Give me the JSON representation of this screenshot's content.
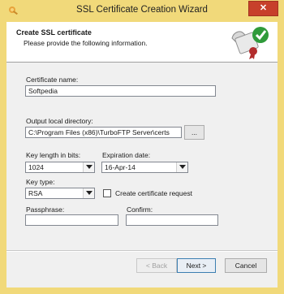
{
  "window": {
    "title": "SSL Certificate Creation Wizard",
    "close_label": "✕"
  },
  "header": {
    "title": "Create SSL certificate",
    "subtitle": "Please provide the following information."
  },
  "form": {
    "certificate_name": {
      "label": "Certificate name:",
      "value": "Softpedia"
    },
    "output_directory": {
      "label": "Output local directory:",
      "value": "C:\\Program Files (x86)\\TurboFTP Server\\certs",
      "browse_label": "..."
    },
    "key_length": {
      "label": "Key length in bits:",
      "value": "1024"
    },
    "expiration_date": {
      "label": "Expiration date:",
      "value": "16-Apr-14"
    },
    "key_type": {
      "label": "Key type:",
      "value": "RSA"
    },
    "create_request": {
      "label": "Create certificate request",
      "checked": false
    },
    "passphrase": {
      "label": "Passphrase:",
      "value": ""
    },
    "confirm": {
      "label": "Confirm:",
      "value": ""
    }
  },
  "footer": {
    "back_label": "< Back",
    "next_label": "Next >",
    "cancel_label": "Cancel"
  },
  "colors": {
    "frame": "#f1d97a",
    "close_button": "#c7402b",
    "content_bg": "#f0f0f0",
    "header_bg": "#ffffff"
  },
  "icons": [
    "wizard-app-icon",
    "certificate-checkmark-icon",
    "chevron-down-icon"
  ]
}
